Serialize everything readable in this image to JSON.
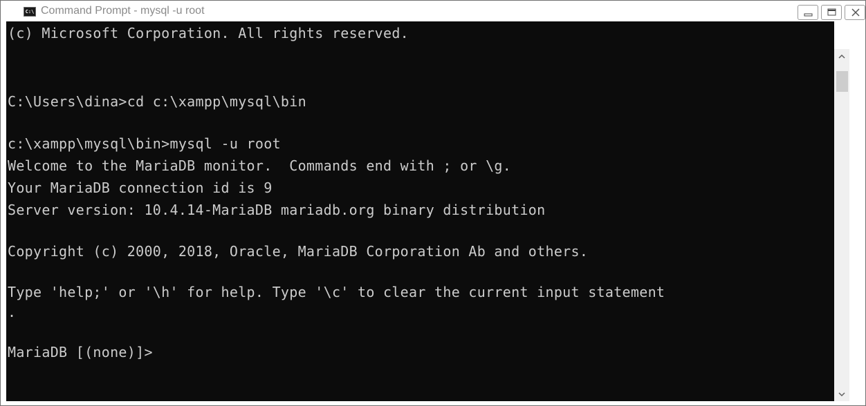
{
  "window": {
    "title": "Command Prompt - mysql  -u root",
    "app_icon_text": "C:\\",
    "controls": {
      "minimize": "minimize-icon",
      "maximize": "maximize-icon",
      "close": "close-icon"
    }
  },
  "console": {
    "lines": [
      "(c) Microsoft Corporation. All rights reserved.",
      "",
      "C:\\Users\\dina>cd c:\\xampp\\mysql\\bin",
      "",
      "c:\\xampp\\mysql\\bin>mysql -u root",
      "Welcome to the MariaDB monitor.  Commands end with ; or \\g.",
      "Your MariaDB connection id is 9",
      "Server version: 10.4.14-MariaDB mariadb.org binary distribution",
      "",
      "Copyright (c) 2000, 2018, Oracle, MariaDB Corporation Ab and others.",
      "",
      "Type 'help;' or '\\h' for help. Type '\\c' to clear the current input statement",
      ".",
      "",
      "MariaDB [(none)]>"
    ],
    "colors": {
      "background": "#0c0c0c",
      "foreground": "#cccccc"
    }
  },
  "scrollbar": {
    "up": "chevron-up-icon",
    "down": "chevron-down-icon"
  }
}
